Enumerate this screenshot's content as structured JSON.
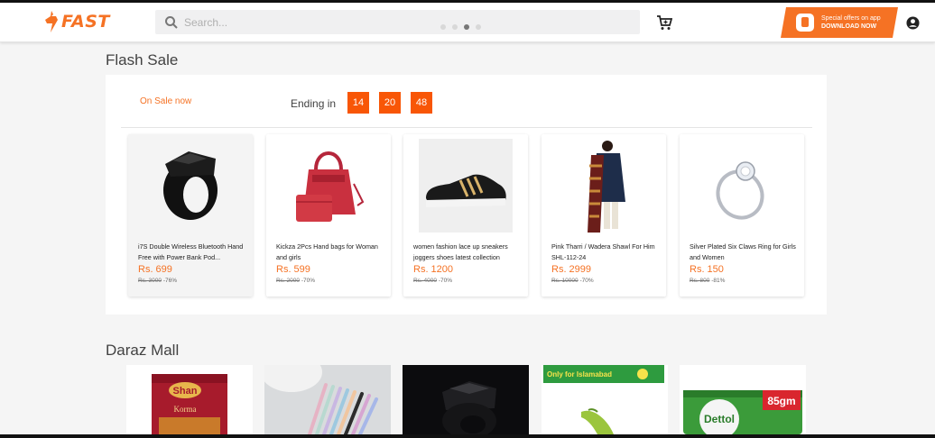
{
  "header": {
    "logo_text": "FAST",
    "search_placeholder": "Search...",
    "promo_line1": "Special offers on app",
    "promo_line2": "DOWNLOAD NOW",
    "brand_color": "#f57224"
  },
  "flash_sale": {
    "title": "Flash Sale",
    "on_sale_label": "On Sale now",
    "ending_label": "Ending in",
    "timer": {
      "hours": "14",
      "minutes": "20",
      "seconds": "48"
    },
    "products": [
      {
        "name": "i7S Double Wireless Bluetooth Hand Free with Power Bank Pod...",
        "price": "Rs. 699",
        "old_price": "Rs. 3000",
        "discount": "-76%",
        "icon": "ring-icon"
      },
      {
        "name": "Kickza 2Pcs Hand bags for Woman and girls",
        "price": "Rs. 599",
        "old_price": "Rs. 2000",
        "discount": "-70%",
        "icon": "handbag-icon"
      },
      {
        "name": "women fashion lace up sneakers joggers shoes latest collection",
        "price": "Rs. 1200",
        "old_price": "Rs. 4000",
        "discount": "-70%",
        "icon": "sneaker-icon"
      },
      {
        "name": "Pink Tharri / Wadera Shawl For Him SHL-112-24",
        "price": "Rs. 2999",
        "old_price": "Rs. 10000",
        "discount": "-70%",
        "icon": "shawl-icon"
      },
      {
        "name": "Silver Plated Six Claws Ring for Girls and Women",
        "price": "Rs. 150",
        "old_price": "Rs. 800",
        "discount": "-81%",
        "icon": "diamond-ring-icon"
      }
    ]
  },
  "mall": {
    "title": "Daraz Mall",
    "tiles": [
      {
        "label": "Shan",
        "sublabel": "Korma"
      },
      {
        "label": ""
      },
      {
        "label": ""
      },
      {
        "label": "Only for Islamabad"
      },
      {
        "label": "Dettol",
        "sublabel": "85gm"
      }
    ]
  }
}
